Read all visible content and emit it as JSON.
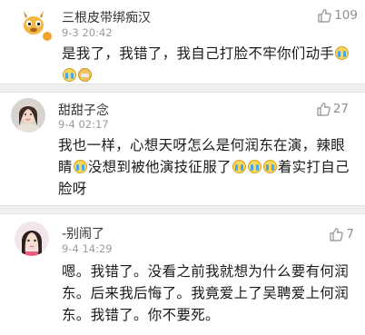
{
  "comments": [
    {
      "username": "三根皮带绑痴汉",
      "time": "9-3 20:42",
      "likes": "109",
      "text_lines": [
        "是我了，我错了，我自己打脸不牢你们动手",
        ""
      ],
      "avatar_icon": "cartoon-deer-avatar"
    },
    {
      "username": "甜甜子念",
      "time": "9-4 02:17",
      "likes": "27",
      "text_lines": [
        "我也一样，心想天呀怎么是何润东在演，辣眼",
        "睛",
        "没想到被他演技征服了",
        "着实打自己",
        "脸呀"
      ],
      "avatar_icon": "girl-photo-avatar"
    },
    {
      "username": "-别闹了",
      "time": "9-4 14:29",
      "likes": "7",
      "text_lines": [
        "嗯。我错了。没看之前我就想为什么要有何润",
        "东。后来我后悔了。我竟爱上了吴聘爱上何润",
        "东。我错了。你不要死。"
      ],
      "avatar_icon": "girl-cartoon-avatar"
    }
  ]
}
